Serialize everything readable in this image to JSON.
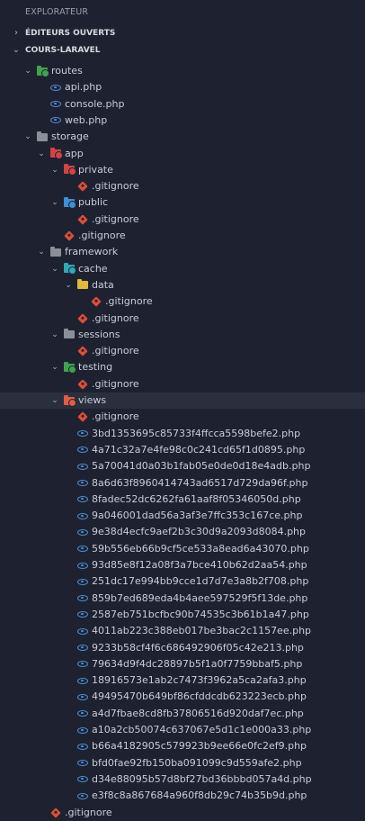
{
  "explorer": {
    "title": "EXPLORATEUR"
  },
  "sections": {
    "open_editors": "ÉDITEURS OUVERTS",
    "project": "COURS-LARAVEL"
  },
  "tree": [
    {
      "depth": 1,
      "type": "folder",
      "label": "routes",
      "expanded": true,
      "folder_color": "#3fa34d",
      "badge": "#3fa34d"
    },
    {
      "depth": 2,
      "type": "php",
      "label": "api.php"
    },
    {
      "depth": 2,
      "type": "php",
      "label": "console.php"
    },
    {
      "depth": 2,
      "type": "php",
      "label": "web.php"
    },
    {
      "depth": 1,
      "type": "folder",
      "label": "storage",
      "expanded": true,
      "folder_color": "#8a8f99",
      "badge": ""
    },
    {
      "depth": 2,
      "type": "folder",
      "label": "app",
      "expanded": true,
      "folder_color": "#d24444",
      "badge": "#d24444"
    },
    {
      "depth": 3,
      "type": "folder",
      "label": "private",
      "expanded": true,
      "folder_color": "#d24444",
      "badge": "#d24444"
    },
    {
      "depth": 4,
      "type": "git",
      "label": ".gitignore"
    },
    {
      "depth": 3,
      "type": "folder",
      "label": "public",
      "expanded": true,
      "folder_color": "#3c8fd8",
      "badge": "#3c8fd8"
    },
    {
      "depth": 4,
      "type": "git",
      "label": ".gitignore"
    },
    {
      "depth": 3,
      "type": "git",
      "label": ".gitignore"
    },
    {
      "depth": 2,
      "type": "folder",
      "label": "framework",
      "expanded": true,
      "folder_color": "#8a8f99",
      "badge": ""
    },
    {
      "depth": 3,
      "type": "folder",
      "label": "cache",
      "expanded": true,
      "folder_color": "#2fa9b8",
      "badge": "#2fa9b8"
    },
    {
      "depth": 4,
      "type": "folder",
      "label": "data",
      "expanded": true,
      "folder_color": "#e2b93b",
      "badge": ""
    },
    {
      "depth": 5,
      "type": "git",
      "label": ".gitignore"
    },
    {
      "depth": 4,
      "type": "git",
      "label": ".gitignore"
    },
    {
      "depth": 3,
      "type": "folder",
      "label": "sessions",
      "expanded": true,
      "folder_color": "#8a8f99",
      "badge": ""
    },
    {
      "depth": 4,
      "type": "git",
      "label": ".gitignore"
    },
    {
      "depth": 3,
      "type": "folder",
      "label": "testing",
      "expanded": true,
      "folder_color": "#3fa34d",
      "badge": "#3fa34d"
    },
    {
      "depth": 4,
      "type": "git",
      "label": ".gitignore"
    },
    {
      "depth": 3,
      "type": "folder",
      "label": "views",
      "expanded": true,
      "folder_color": "#e45b45",
      "badge": "#e45b45",
      "selected": true
    },
    {
      "depth": 4,
      "type": "git",
      "label": ".gitignore"
    },
    {
      "depth": 4,
      "type": "php",
      "label": "3bd1353695c85733f4ffcca5598befe2.php"
    },
    {
      "depth": 4,
      "type": "php",
      "label": "4a71c32a7e4fe98c0c241cd65f1d0895.php"
    },
    {
      "depth": 4,
      "type": "php",
      "label": "5a70041d0a03b1fab05e0de0d18e4adb.php"
    },
    {
      "depth": 4,
      "type": "php",
      "label": "8a6d63f8960414743ad6517d729da96f.php"
    },
    {
      "depth": 4,
      "type": "php",
      "label": "8fadec52dc6262fa61aaf8f05346050d.php"
    },
    {
      "depth": 4,
      "type": "php",
      "label": "9a046001dad56a3af3e7ffc353c167ce.php"
    },
    {
      "depth": 4,
      "type": "php",
      "label": "9e38d4ecfc9aef2b3c30d9a2093d8084.php"
    },
    {
      "depth": 4,
      "type": "php",
      "label": "59b556eb66b9cf5ce533a8ead6a43070.php"
    },
    {
      "depth": 4,
      "type": "php",
      "label": "93d85e8f12a08f3a7bce410b62d2aa54.php"
    },
    {
      "depth": 4,
      "type": "php",
      "label": "251dc17e994bb9cce1d7d7e3a8b2f708.php"
    },
    {
      "depth": 4,
      "type": "php",
      "label": "859b7ed689eda4b4aee597529f5f13de.php"
    },
    {
      "depth": 4,
      "type": "php",
      "label": "2587eb751bcfbc90b74535c3b61b1a47.php"
    },
    {
      "depth": 4,
      "type": "php",
      "label": "4011ab223c388eb017be3bac2c1157ee.php"
    },
    {
      "depth": 4,
      "type": "php",
      "label": "9233b58cf4f6c686492906f05c42e213.php"
    },
    {
      "depth": 4,
      "type": "php",
      "label": "79634d9f4dc28897b5f1a0f7759bbaf5.php"
    },
    {
      "depth": 4,
      "type": "php",
      "label": "18916573e1ab2c7473f3962a5ca2afa3.php"
    },
    {
      "depth": 4,
      "type": "php",
      "label": "49495470b649bf86cfddcdb623223ecb.php"
    },
    {
      "depth": 4,
      "type": "php",
      "label": "a4d7fbae8cd8fb37806516d920daf7ec.php"
    },
    {
      "depth": 4,
      "type": "php",
      "label": "a10a2cb50074c637067e5d1c1e000a33.php"
    },
    {
      "depth": 4,
      "type": "php",
      "label": "b66a4182905c579923b9ee66e0fc2ef9.php"
    },
    {
      "depth": 4,
      "type": "php",
      "label": "bfd0fae92fb150ba091099c9d559afe2.php"
    },
    {
      "depth": 4,
      "type": "php",
      "label": "d34e88095b57d8bf27bd36bbbd057a4d.php"
    },
    {
      "depth": 4,
      "type": "php",
      "label": "e3f8c8a867684a960f8db29c74b35b9d.php"
    },
    {
      "depth": 2,
      "type": "git",
      "label": ".gitignore"
    }
  ]
}
